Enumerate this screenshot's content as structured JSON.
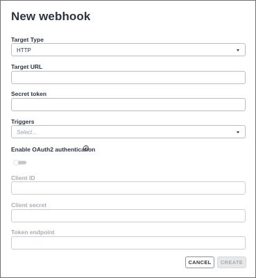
{
  "dialog": {
    "title": "New webhook",
    "target_type": {
      "label": "Target Type",
      "value": "HTTP"
    },
    "target_url": {
      "label": "Target URL",
      "value": ""
    },
    "secret_token": {
      "label": "Secret token",
      "value": ""
    },
    "triggers": {
      "label": "Triggers",
      "placeholder": "Select..."
    },
    "oauth": {
      "label": "Enable OAuth2 authentication",
      "enabled": false
    },
    "client_id": {
      "label": "Client ID",
      "value": ""
    },
    "client_secret": {
      "label": "Client secret",
      "value": ""
    },
    "token_endpoint": {
      "label": "Token endpoint",
      "value": ""
    },
    "buttons": {
      "cancel": "CANCEL",
      "create": "CREATE"
    }
  },
  "colors": {
    "text": "#2d3440",
    "border": "#b9bdc3",
    "disabled_text": "#a9adb3",
    "toggle_off": "#c3c6cb"
  }
}
